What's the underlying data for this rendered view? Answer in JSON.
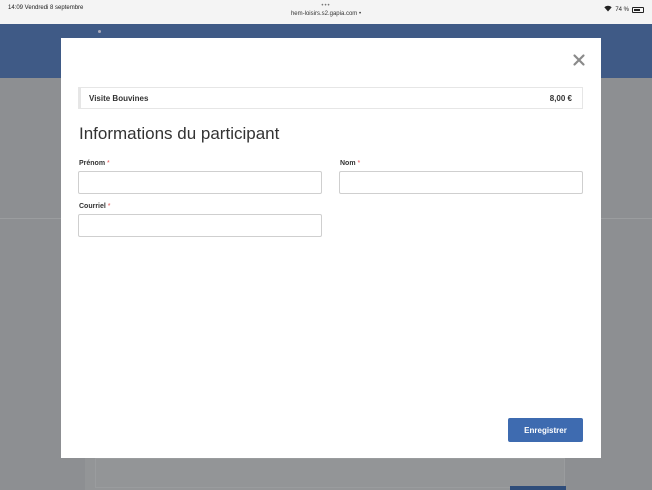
{
  "status_bar": {
    "time_date": "14:09  Vendredi 8 septembre",
    "dots": "•••",
    "url": "hem-loisirs.s2.gapia.com •",
    "battery": "74 %"
  },
  "modal": {
    "close_icon": "close-icon",
    "product": {
      "name": "Visite Bouvines",
      "price": "8,00 €"
    },
    "section_title": "Informations du participant",
    "fields": {
      "prenom": {
        "label": "Prénom",
        "required_mark": "*",
        "value": ""
      },
      "nom": {
        "label": "Nom",
        "required_mark": "*",
        "value": ""
      },
      "courriel": {
        "label": "Courriel",
        "required_mark": "*",
        "value": ""
      }
    },
    "save_button": "Enregistrer"
  },
  "colors": {
    "primary_button": "#3e6bb0",
    "header_blue": "#3f5a86",
    "required_star": "#e55353"
  }
}
